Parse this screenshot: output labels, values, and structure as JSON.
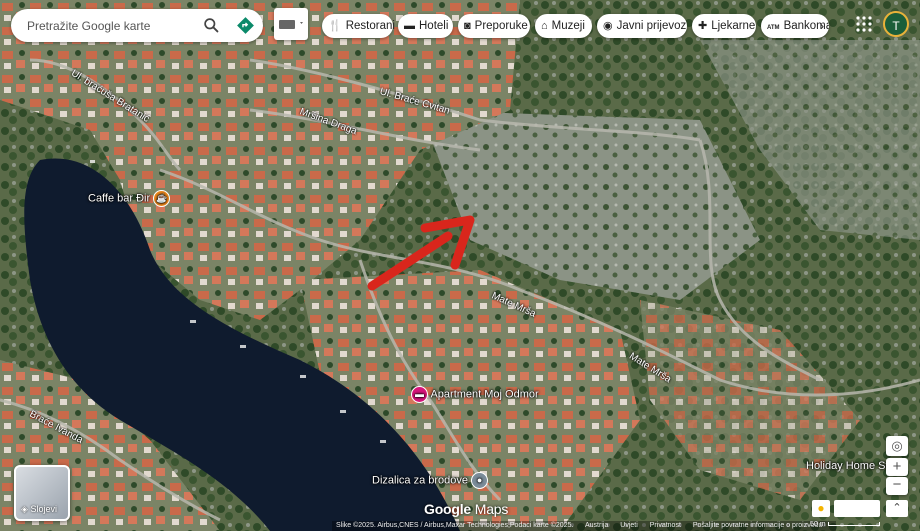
{
  "search": {
    "placeholder": "Pretražite Google karte"
  },
  "chips": [
    {
      "label": "Restorani",
      "icon": "fork-knife-icon"
    },
    {
      "label": "Hoteli",
      "icon": "bed-icon"
    },
    {
      "label": "Preporuke",
      "icon": "camera-icon"
    },
    {
      "label": "Muzeji",
      "icon": "museum-icon"
    },
    {
      "label": "Javni prijevoz",
      "icon": "bus-icon"
    },
    {
      "label": "Ljekarne",
      "icon": "pharmacy-icon"
    },
    {
      "label": "Bankomati",
      "icon": "atm-icon"
    }
  ],
  "atm_badge": "ATM",
  "account": {
    "initial": "T",
    "color": "#1b5e3a"
  },
  "places": {
    "cafe": "Caffe bar Đir",
    "apartment": "Apartment Moj Odmor",
    "crane": "Dizalica za brodove",
    "holiday": "Holiday Home Stell"
  },
  "roads": {
    "brace_cvitan": "Ul. Braće Cvitan",
    "brace_cvitan_2": "Ul. braće Cvitan",
    "brace_bratanic": "Ul. braćuša Bratanić",
    "mrsina_draga": "Mršina Draga",
    "mate_mrsa_1": "Mate Mrša",
    "mate_mrsa_2": "Mate Mrša",
    "brace_ivanda": "Braće Ivanda"
  },
  "layers_label": "Slojevi",
  "logo": {
    "google": "Google",
    "maps": "Maps"
  },
  "footer": {
    "imagery": "Slike ©2025. Airbus,CNES / Airbus,Maxar Technologies,Podaci karte ©2025.",
    "country": "Austrija",
    "terms": "Uvjeti",
    "privacy": "Privatnost",
    "feedback": "Pošaljite povratne informacije o proizvodu",
    "scale": "50 m"
  },
  "colors": {
    "arrow": "#d9261c",
    "directions": "#0b8a6a",
    "cafe_icon": "#f08a1c",
    "hotel_icon": "#d6157a"
  }
}
